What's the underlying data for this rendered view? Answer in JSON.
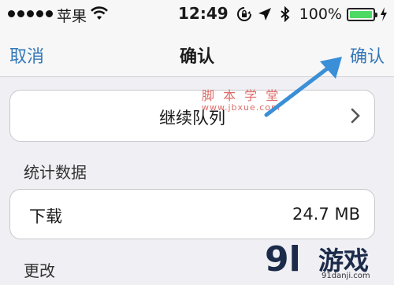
{
  "status_bar": {
    "carrier": "苹果",
    "time": "12:49",
    "battery_percent": "100%",
    "battery_level": 1.0,
    "icons": [
      "signal-dots",
      "wifi-icon",
      "rotation-lock-icon",
      "location-arrow-icon",
      "bluetooth-icon",
      "battery-icon",
      "charging-bolt-icon"
    ]
  },
  "nav": {
    "cancel_label": "取消",
    "title": "确认",
    "confirm_label": "确认"
  },
  "watermark": {
    "text": "脚 本 学 堂",
    "url": "www.jbxue.com"
  },
  "queue": {
    "label": "继续队列"
  },
  "stats": {
    "header": "统计数据",
    "download_label": "下载",
    "download_value": "24.7 MB"
  },
  "changes": {
    "header": "更改"
  },
  "logo": {
    "mark": "9l",
    "text": "游戏",
    "url": "91danji.com"
  },
  "colors": {
    "accent": "#3478b9",
    "background": "#efeff4",
    "battery": "#4cd964",
    "annotation_arrow": "#3a8fd6",
    "watermark": "#d9534f"
  }
}
